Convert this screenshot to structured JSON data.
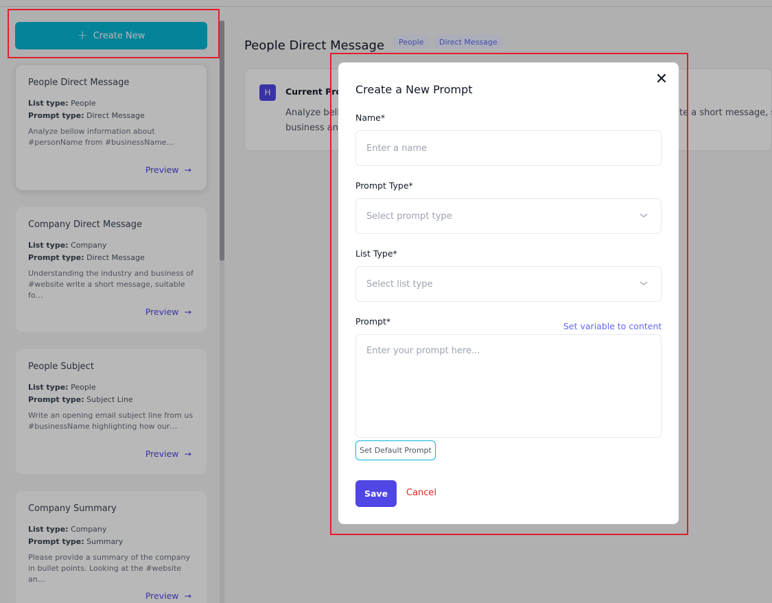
{
  "sidebar": {
    "create_button": "Create New",
    "cards": [
      {
        "title": "People Direct Message",
        "list_type_label": "List type:",
        "list_type": "People",
        "prompt_type_label": "Prompt type:",
        "prompt_type": "Direct Message",
        "desc1": "Analyze bellow information about",
        "desc2": "#personName from #businessName…",
        "preview": "Preview"
      },
      {
        "title": "Company Direct Message",
        "list_type_label": "List type:",
        "list_type": "Company",
        "prompt_type_label": "Prompt type:",
        "prompt_type": "Direct Message",
        "desc1": "Understanding the industry and business of",
        "desc2": "#website write a short message, suitable fo…",
        "preview": "Preview"
      },
      {
        "title": "People Subject",
        "list_type_label": "List type:",
        "list_type": "People",
        "prompt_type_label": "Prompt type:",
        "prompt_type": "Subject Line",
        "desc1": "Write an opening email subject line from us",
        "desc2": "#businessName highlighting how our…",
        "preview": "Preview"
      },
      {
        "title": "Company Summary",
        "list_type_label": "List type:",
        "list_type": "Company",
        "prompt_type_label": "Prompt type:",
        "prompt_type": "Summary",
        "desc1": "Please provide a summary of the company",
        "desc2": "in bullet points. Looking at the #website an…",
        "preview": "Preview"
      }
    ]
  },
  "main": {
    "title": "People Direct Message",
    "tags": [
      "People",
      "Direct Message"
    ],
    "badge": "H",
    "current_label": "Current Prompt",
    "current_text1": "Analyze bellow information about #personName from #businessName",
    "current_text2": "business and",
    "current_text_right": "te a short message, su"
  },
  "modal": {
    "title": "Create a New Prompt",
    "close": "✕",
    "name_label": "Name*",
    "name_placeholder": "Enter a name",
    "prompt_type_label": "Prompt Type*",
    "prompt_type_placeholder": "Select prompt type",
    "list_type_label": "List Type*",
    "list_type_placeholder": "Select list type",
    "prompt_label": "Prompt*",
    "set_variable": "Set variable to content",
    "prompt_placeholder": "Enter your prompt here...",
    "set_default": "Set Default Prompt",
    "save": "Save",
    "cancel": "Cancel"
  },
  "colors": {
    "accent": "#4f46e5",
    "cyan": "#06b6d4",
    "highlight": "#e11d2a",
    "danger": "#dc2626"
  }
}
